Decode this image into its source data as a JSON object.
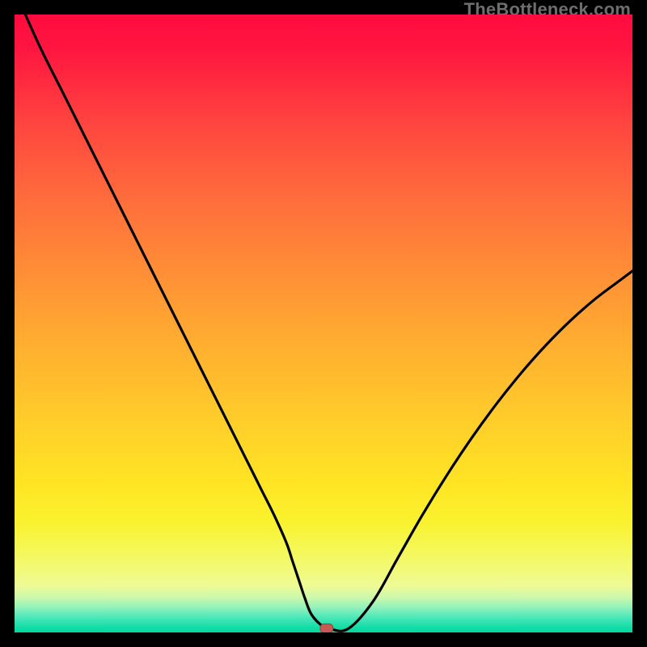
{
  "watermark": "TheBottleneck.com",
  "marker": {
    "color": "#c65a54",
    "stroke": "#9e3f3a"
  },
  "chart_data": {
    "type": "line",
    "title": "",
    "xlabel": "",
    "ylabel": "",
    "xlim": [
      0,
      100
    ],
    "ylim": [
      0,
      100
    ],
    "grid": false,
    "series": [
      {
        "name": "bottleneck-curve",
        "x": [
          0,
          4,
          8,
          12,
          16,
          20,
          24,
          28,
          32,
          36,
          38,
          40,
          42,
          44,
          45,
          46,
          47,
          48,
          49.5,
          51,
          54,
          58,
          62,
          66,
          70,
          74,
          78,
          82,
          86,
          90,
          94,
          98,
          100
        ],
        "y": [
          104,
          95,
          87,
          79,
          71,
          63,
          55,
          47,
          39,
          31,
          27,
          23,
          19,
          14.5,
          11.5,
          8.5,
          5.5,
          3,
          1.3,
          0.6,
          0.6,
          5,
          12,
          19,
          25.5,
          31.5,
          37,
          42,
          46.5,
          50.5,
          54,
          57,
          58.5
        ]
      }
    ],
    "marker_point": {
      "x": 50.5,
      "y": 0.6
    }
  }
}
